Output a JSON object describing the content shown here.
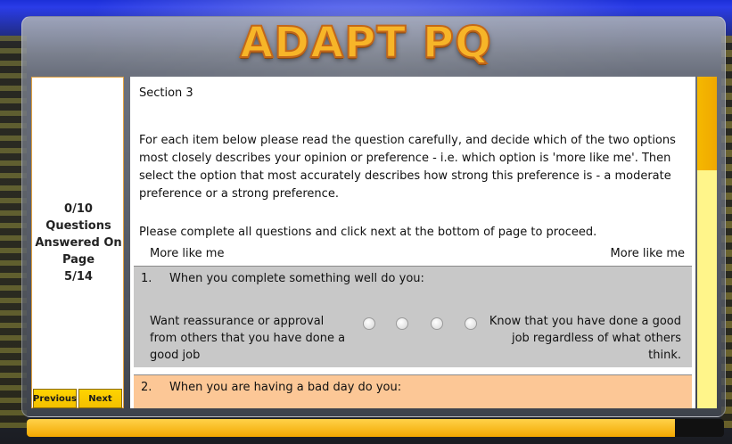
{
  "app": {
    "title": "ADAPT PQ"
  },
  "progress": {
    "answered": "0/10",
    "line1": "Questions",
    "line2": "Answered On",
    "line3": "Page",
    "page": "5/14"
  },
  "nav": {
    "previous_label": "Previous",
    "next_label": "Next"
  },
  "section": {
    "title": "Section 3",
    "instructions": "For each item below please read the question carefully, and decide which of the two options most closely describes your opinion or preference - i.e. which option is 'more like me'.  Then select the option that most accurately describes how strong this preference is - a moderate preference or a strong preference.",
    "complete_note": "Please complete all questions and click next at the bottom of page to proceed.",
    "more_left": "More like me",
    "more_right": "More like me"
  },
  "questions": [
    {
      "number": "1.",
      "text": "When you complete something well do you:",
      "option_left": "Want reassurance or approval from others that you have done a good job",
      "option_right": "Know that you have done a good job regardless of what others think."
    },
    {
      "number": "2.",
      "text": "When you are having a bad day do you:"
    }
  ],
  "colors": {
    "title": "#f7b528",
    "question_odd_bg": "#c8c8c8",
    "question_even_bg": "#fcc796",
    "button": "#ffd400"
  },
  "bottom_progress": 0.93
}
